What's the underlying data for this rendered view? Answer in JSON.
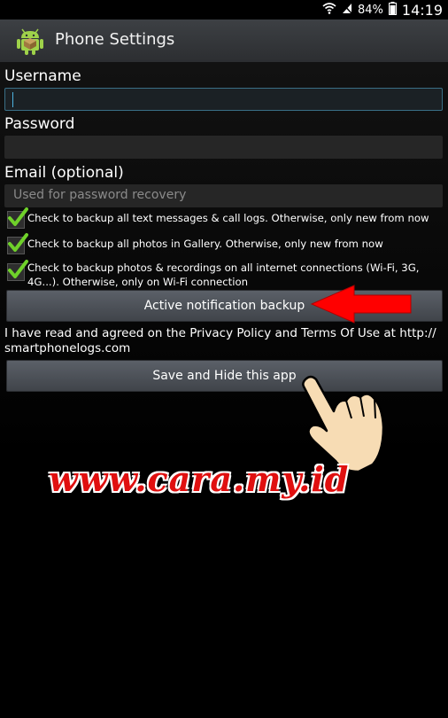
{
  "status_bar": {
    "battery": "84%",
    "time": "14:19"
  },
  "header": {
    "title": "Phone Settings"
  },
  "form": {
    "username_label": "Username",
    "username_value": "",
    "password_label": "Password",
    "email_label": "Email (optional)",
    "email_placeholder": "Used for password recovery"
  },
  "options": [
    {
      "label": "Check to backup all text messages & call logs. Otherwise, only new from now",
      "checked": true
    },
    {
      "label": "Check to backup all photos in Gallery. Otherwise, only new from now",
      "checked": true
    },
    {
      "label": "Check to backup photos & recordings on all internet connections (Wi-Fi, 3G, 4G...). Otherwise, only on Wi-Fi connection",
      "checked": true
    }
  ],
  "buttons": {
    "notification_backup": "Active notification backup",
    "save_hide": "Save and Hide this app"
  },
  "privacy_text": "I have read and agreed on the Privacy Policy and Terms Of Use at http:// smartphonelogs.com",
  "watermark": "www.cara.my.id",
  "colors": {
    "accent_check": "#6fd12a",
    "arrow": "#ff0000",
    "watermark": "#e01010"
  }
}
